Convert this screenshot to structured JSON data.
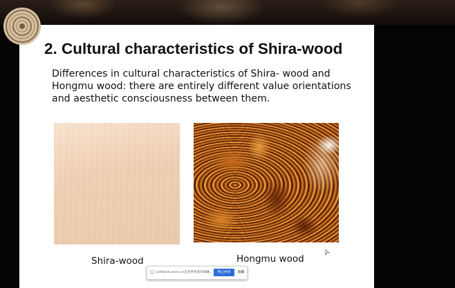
{
  "slide": {
    "title": "2. Cultural characteristics of Shira-wood",
    "body_lines": [
      "Differences in cultural characteristics of Shira- wood and",
      "Hongmu wood: there are entirely different value orientations",
      "and aesthetic consciousness between them."
    ],
    "images": [
      {
        "caption": "Shira-wood"
      },
      {
        "caption": "Hongmu wood"
      }
    ]
  },
  "toast": {
    "message": "us06web.zoom.us正在共享您的屏幕。",
    "share_button": "停止共享",
    "hide_button": "隐藏",
    "accent_color": "#2c6fd8"
  },
  "icons": [
    "logo-ring-icon",
    "cursor-arrow-icon",
    "screen-share-icon"
  ]
}
